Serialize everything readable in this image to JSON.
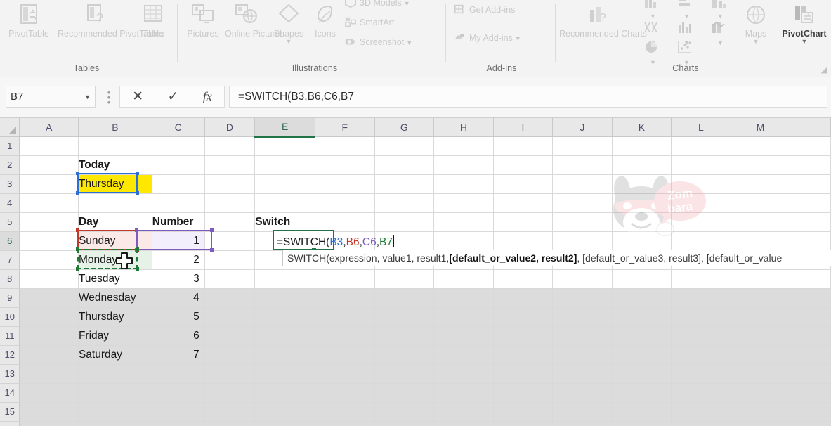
{
  "ribbon": {
    "groups": [
      {
        "name": "Tables",
        "label": "Tables",
        "buttons": [
          {
            "label": "PivotTable",
            "icon": "pivot-table-icon"
          },
          {
            "label": "Recommended PivotTables",
            "icon": "recommended-pivottables-icon"
          },
          {
            "label": "Table",
            "icon": "table-icon"
          }
        ]
      },
      {
        "name": "Illustrations",
        "label": "Illustrations",
        "buttons": [
          {
            "label": "Pictures",
            "icon": "pictures-icon"
          },
          {
            "label": "Online Pictures",
            "icon": "online-pictures-icon"
          },
          {
            "label": "Shapes",
            "icon": "shapes-icon"
          },
          {
            "label": "Icons",
            "icon": "icons-icon"
          },
          {
            "label": "3D Models",
            "icon": "3d-models-icon"
          },
          {
            "label": "SmartArt",
            "icon": "smartart-icon"
          },
          {
            "label": "Screenshot",
            "icon": "screenshot-icon"
          }
        ]
      },
      {
        "name": "Add-ins",
        "label": "Add-ins",
        "buttons": [
          {
            "label": "Get Add-ins",
            "icon": "get-addins-icon"
          },
          {
            "label": "My Add-ins",
            "icon": "my-addins-icon"
          }
        ]
      },
      {
        "name": "Charts",
        "label": "Charts",
        "buttons": [
          {
            "label": "Recommended Charts",
            "icon": "recommended-charts-icon"
          },
          {
            "label": "",
            "icon": "column-chart-icon"
          },
          {
            "label": "",
            "icon": "line-chart-icon"
          },
          {
            "label": "",
            "icon": "hierarchy-chart-icon"
          },
          {
            "label": "",
            "icon": "stock-chart-icon"
          },
          {
            "label": "",
            "icon": "bar-chart-icon"
          },
          {
            "label": "",
            "icon": "combo-chart-icon"
          },
          {
            "label": "",
            "icon": "pie-chart-icon"
          },
          {
            "label": "",
            "icon": "scatter-chart-icon"
          },
          {
            "label": "Maps",
            "icon": "maps-icon"
          },
          {
            "label": "PivotChart",
            "icon": "pivotchart-icon"
          }
        ]
      }
    ]
  },
  "formula_bar": {
    "name_box_value": "B7",
    "cancel_label": "✕",
    "enter_label": "✓",
    "fx_label": "fx",
    "formula": "=SWITCH(B3,B6,C6,B7"
  },
  "sheet": {
    "column_headers": [
      "A",
      "B",
      "C",
      "D",
      "E",
      "F",
      "G",
      "H",
      "I",
      "J",
      "K",
      "L",
      "M"
    ],
    "active_column": "E",
    "active_row": "6",
    "row_headers": [
      "1",
      "2",
      "3",
      "4",
      "5",
      "6",
      "7",
      "8",
      "9",
      "10",
      "11",
      "12",
      "13",
      "14",
      "15"
    ],
    "cells": {
      "B2": "Today",
      "B3": "Thursday",
      "B5": "Day",
      "C5": "Number",
      "E5": "Switch",
      "B6": "Sunday",
      "C6": "1",
      "B7": "Monday",
      "C7": "2",
      "B8": "Tuesday",
      "C8": "3",
      "B9": "Wednesday",
      "C9": "4",
      "B10": "Thursday",
      "C10": "5",
      "B11": "Friday",
      "C11": "6",
      "B12": "Saturday",
      "C12": "7"
    }
  },
  "editing": {
    "active_cell": "E6",
    "formula_parts": [
      {
        "text": "=SWITCH(",
        "color": "default"
      },
      {
        "text": "B3",
        "color": "blue"
      },
      {
        "text": ",",
        "color": "default"
      },
      {
        "text": "B6",
        "color": "red"
      },
      {
        "text": ",",
        "color": "default"
      },
      {
        "text": "C6",
        "color": "purple"
      },
      {
        "text": ",",
        "color": "default"
      },
      {
        "text": "B7",
        "color": "green"
      }
    ],
    "tooltip_parts": [
      {
        "text": "SWITCH(expression, value1, result1, ",
        "bold": false
      },
      {
        "text": "[default_or_value2, result2]",
        "bold": true
      },
      {
        "text": ", [default_or_value3, result3], [default_or_value",
        "bold": false
      }
    ]
  },
  "references": {
    "blue": {
      "cell": "B3",
      "color": "#2a6fd6"
    },
    "red": {
      "cell": "B6",
      "color": "#c0392b"
    },
    "purple": {
      "cell": "C6",
      "color": "#7d5bbe"
    },
    "green": {
      "cell": "B7",
      "color": "#1f7a35"
    }
  },
  "colors": {
    "accent_green": "#217346",
    "highlight_yellow": "#ffe800",
    "ribbon_bg": "#f3f3f3",
    "header_bg": "#e8e8e8"
  },
  "watermark": {
    "text_line1": "Zom",
    "text_line2": "bara",
    "name": "zombara-logo"
  },
  "cursor": {
    "name": "cell-select-cursor"
  }
}
